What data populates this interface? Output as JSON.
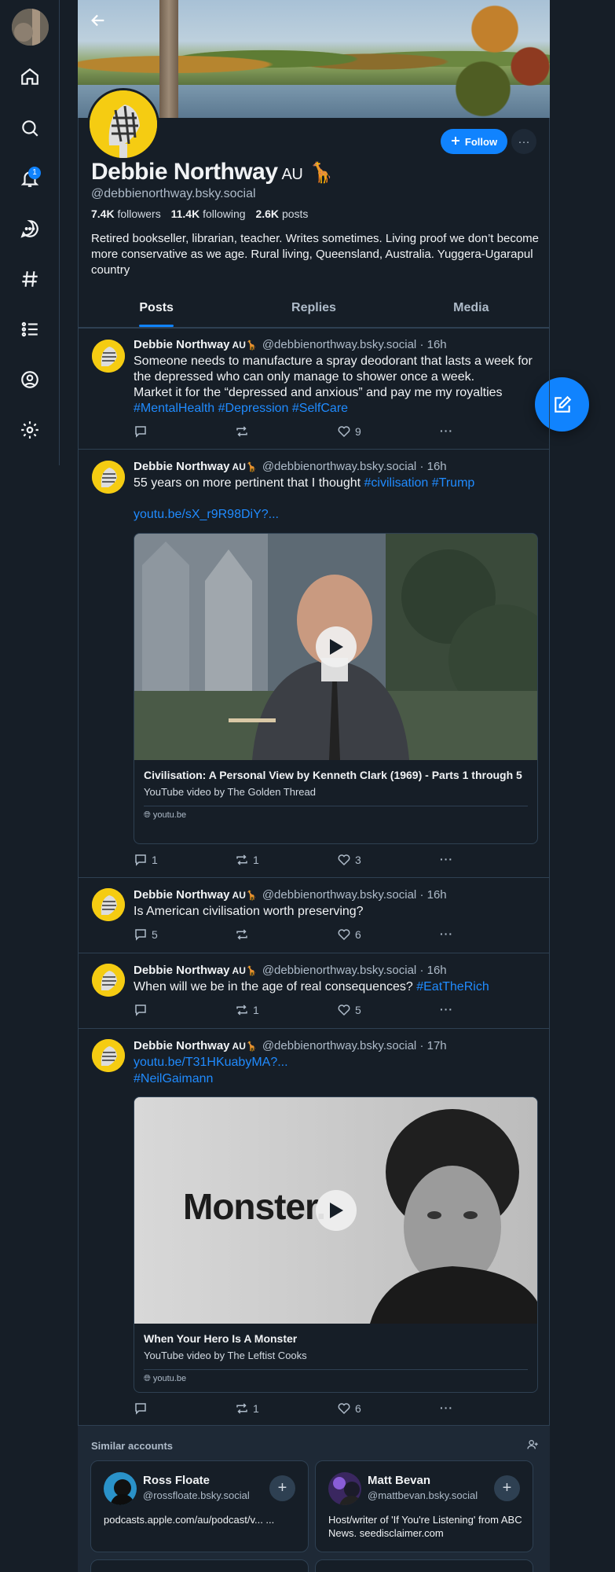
{
  "nav": {
    "items": [
      "home-icon",
      "search-icon",
      "bell-icon",
      "chat-icon",
      "hashtag-icon",
      "list-icon",
      "profile-icon",
      "gear-icon"
    ],
    "notification_badge": "1"
  },
  "profile": {
    "display_name": "Debbie Northway",
    "name_suffix": "AU",
    "name_emoji": "🦒",
    "handle": "@debbienorthway.bsky.social",
    "followers_count": "7.4K",
    "followers_label": "followers",
    "following_count": "11.4K",
    "following_label": "following",
    "posts_count": "2.6K",
    "posts_label": "posts",
    "bio": "Retired bookseller, librarian, teacher. Writes sometimes. Living proof we don’t become more conservative as we age. Rural living, Queensland, Australia. Yuggera-Ugarapul country",
    "follow_label": "Follow",
    "more_label": "···"
  },
  "tabs": [
    "Posts",
    "Replies",
    "Media"
  ],
  "posts": [
    {
      "author": "Debbie Northway",
      "au": "AU",
      "emoji": "🦒",
      "handle": "@debbienorthway.bsky.social",
      "time": "· 16h",
      "text_lines": [
        "Someone needs to manufacture a spray deodorant that lasts a week for the depressed who can only manage to shower once a week.",
        "Market it for the “depressed and anxious” and pay me my royalties"
      ],
      "tags": "#MentalHealth #Depression #SelfCare",
      "replies": "",
      "reposts": "",
      "likes": "9"
    },
    {
      "author": "Debbie Northway",
      "au": "AU",
      "emoji": "🦒",
      "handle": "@debbienorthway.bsky.social",
      "time": "· 16h",
      "text": "55 years on more pertinent that I thought ",
      "tags": "#civilisation #Trump",
      "link": "youtu.be/sX_r9R98DiY?...",
      "embed": {
        "title": "Civilisation: A Personal View by Kenneth Clark (1969) - Parts 1 through 5",
        "description": "YouTube video by The Golden Thread",
        "domain": "youtu.be"
      },
      "replies": "1",
      "reposts": "1",
      "likes": "3"
    },
    {
      "author": "Debbie Northway",
      "au": "AU",
      "emoji": "🦒",
      "handle": "@debbienorthway.bsky.social",
      "time": "· 16h",
      "text": "Is American civilisation worth preserving?",
      "replies": "5",
      "reposts": "",
      "likes": "6"
    },
    {
      "author": "Debbie Northway",
      "au": "AU",
      "emoji": "🦒",
      "handle": "@debbienorthway.bsky.social",
      "time": "· 16h",
      "text": "When will we be in the age of real consequences? ",
      "tags": "#EatTheRich",
      "replies": "",
      "reposts": "1",
      "likes": "5"
    },
    {
      "author": "Debbie Northway",
      "au": "AU",
      "emoji": "🦒",
      "handle": "@debbienorthway.bsky.social",
      "time": "· 17h",
      "link": "youtu.be/T31HKuabyMA?...",
      "tags": "#NeilGaimann",
      "embed": {
        "thumb_text": "Monster.",
        "title": "When Your Hero Is A Monster",
        "description": "YouTube video by The Leftist Cooks",
        "domain": "youtu.be"
      },
      "replies": "",
      "reposts": "1",
      "likes": "6"
    }
  ],
  "similar": {
    "title": "Similar accounts",
    "accounts": [
      {
        "name": "Ross Floate",
        "handle": "@rossfloate.bsky.social",
        "description": "podcasts.apple.com/au/podcast/v... ..."
      },
      {
        "name": "Matt Bevan",
        "handle": "@mattbevan.bsky.social",
        "description": "Host/writer of 'If You're Listening' from ABC News. seedisclaimer.com"
      }
    ]
  },
  "colors": {
    "background": "#161e27",
    "accent": "#1083fe",
    "link": "#208bfe",
    "muted_text": "#aebbc9",
    "border": "#2e4052",
    "avatar_yellow": "#f5cc12"
  }
}
